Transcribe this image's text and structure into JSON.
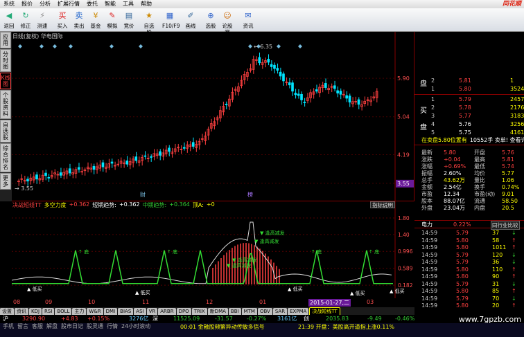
{
  "menu": [
    "系统",
    "报价",
    "分析",
    "扩展行情",
    "委托",
    "智能",
    "工具",
    "帮助"
  ],
  "brand": "同花顺",
  "toolbar": [
    {
      "label": "返回",
      "icon": "back-icon"
    },
    {
      "label": "修正",
      "icon": "refresh-icon"
    },
    {
      "label": "测速",
      "icon": "speed-icon"
    },
    {
      "label": "买入",
      "icon": "buy-icon"
    },
    {
      "label": "卖出",
      "icon": "sell-icon"
    },
    {
      "label": "基金",
      "icon": "fund-icon"
    },
    {
      "label": "模拟",
      "icon": "simulate-icon"
    },
    {
      "label": "竞价",
      "icon": "auction-icon"
    },
    {
      "label": "自选股",
      "icon": "watchlist-icon"
    },
    {
      "label": "F10/F9",
      "icon": "f10-icon"
    },
    {
      "label": "画线",
      "icon": "draw-icon"
    },
    {
      "label": "选股",
      "icon": "select-icon"
    },
    {
      "label": "论股堂",
      "icon": "forum-icon"
    },
    {
      "label": "资讯",
      "icon": "news-icon"
    }
  ],
  "sidetabs": [
    "应用",
    "分时图",
    "K线图",
    "个股资料",
    "自选股",
    "综合排名",
    "更多"
  ],
  "kheader": "日线(复权)  华电国际",
  "price_labels": [
    {
      "v": "5.90"
    },
    {
      "v": "5.04"
    },
    {
      "v": "4.19"
    },
    {
      "v": "3.55"
    }
  ],
  "chart_notes": {
    "high": "6.35",
    "low": "3.55",
    "mark1": "财",
    "mark2": "榜"
  },
  "indicator": {
    "name": "决战短线TT",
    "sub": "多空力度",
    "v1": "+0.362",
    "short_label": "短期趋势:",
    "short_val": "+0.362",
    "mid_label": "中期趋势:",
    "mid_val": "+0.364",
    "top_label": "顶A:",
    "top_val": "+0",
    "btn": "指标说明",
    "labels": {
      "bottom": "底",
      "buy": "低买",
      "top": "逢高减发"
    },
    "axis": [
      "1.80",
      "1.40",
      "0.996",
      "0.589",
      "0.182"
    ]
  },
  "xaxis": [
    "08",
    "09",
    "10",
    "11",
    "12",
    "01",
    "02",
    "03"
  ],
  "date_tag": "2015-01-27,二",
  "tabs": [
    "设置",
    "资讯",
    "KDJ",
    "RSI",
    "BOLL",
    "主力",
    "W&R",
    "DMI",
    "BIAS",
    "ASI",
    "VR",
    "ARBR",
    "DPO",
    "TRIX",
    "新DMA",
    "BBI",
    "MTM",
    "OBV",
    "SAR",
    "EXPMA",
    "决战短线TT"
  ],
  "status": {
    "market": "沪",
    "index": "3290.90",
    "chg": "+4.83",
    "pct": "+0.15%",
    "amt": "3276亿",
    "market2": "深",
    "index2": "11525.09",
    "chg2": "-31.57",
    "pct2": "-0.27%",
    "amt2": "3161亿",
    "cy": "创",
    "index3": "2035.83",
    "chg3": "-9.49",
    "pct3": "-0.46%"
  },
  "bottom": {
    "links": [
      "手机",
      "留言",
      "客服",
      "解盘",
      "股市日记",
      "股灵通",
      "行情",
      "24小时滚动"
    ],
    "news1": "00:01 金融股频繁异动传敏多信号",
    "news2": "21:39 开盘：美股高开道指上涨0.11%"
  },
  "watermark": "www.7gpzb.com",
  "orderbook": {
    "sell": [
      {
        "n": "2",
        "p": "5.81",
        "v": "1"
      },
      {
        "n": "1",
        "p": "5.80",
        "v": "3524"
      }
    ],
    "buy": [
      {
        "n": "1",
        "p": "5.79",
        "v": "2457"
      },
      {
        "n": "2",
        "p": "5.78",
        "v": "2176"
      },
      {
        "n": "3",
        "p": "5.77",
        "v": "3183"
      },
      {
        "n": "4",
        "p": "5.76",
        "v": "3256"
      },
      {
        "n": "5",
        "p": "5.75",
        "v": "4161"
      }
    ],
    "sell_label": "盘",
    "buy_label1": "买",
    "buy_label2": "盘",
    "note": "在卖盘5.80位置有",
    "note2": "10552手 卖单! 查看详情"
  },
  "quote": [
    [
      "最新",
      "5.80",
      "开盘",
      "5.76"
    ],
    [
      "涨跌",
      "+0.04",
      "最高",
      "5.81"
    ],
    [
      "涨幅",
      "+0.69%",
      "最低",
      "5.74"
    ],
    [
      "振幅",
      "2.60%",
      "均价",
      "5.77"
    ],
    [
      "总手",
      "43.62万",
      "量比",
      "1.06"
    ],
    [
      "金额",
      "2.54亿",
      "换手",
      "0.74%"
    ],
    [
      "市盈",
      "12.34",
      "市盈(动)",
      "9.01"
    ],
    [
      "股本",
      "88.07亿",
      "流通",
      "58.50"
    ],
    [
      "外盘",
      "23.04万",
      "内盘",
      "20.5"
    ]
  ],
  "sector": {
    "name": "电力",
    "pct": "0.22%",
    "btn": "同行业比较"
  },
  "ticks": [
    [
      "14:59",
      "5.79",
      "37"
    ],
    [
      "14:59",
      "5.80",
      "58"
    ],
    [
      "14:59",
      "5.80",
      "1011"
    ],
    [
      "14:59",
      "5.79",
      "120"
    ],
    [
      "14:59",
      "5.79",
      "36"
    ],
    [
      "14:59",
      "5.80",
      "110"
    ],
    [
      "14:59",
      "5.80",
      "90"
    ],
    [
      "14:59",
      "5.79",
      "31"
    ],
    [
      "14:59",
      "5.80",
      "85"
    ],
    [
      "14:59",
      "5.79",
      "70"
    ],
    [
      "14:59",
      "5.80",
      "20"
    ]
  ],
  "colors": {
    "up": "#ff4040",
    "down": "#00e5ff",
    "ind_line": "#33dd33",
    "accent": "#ff0"
  }
}
